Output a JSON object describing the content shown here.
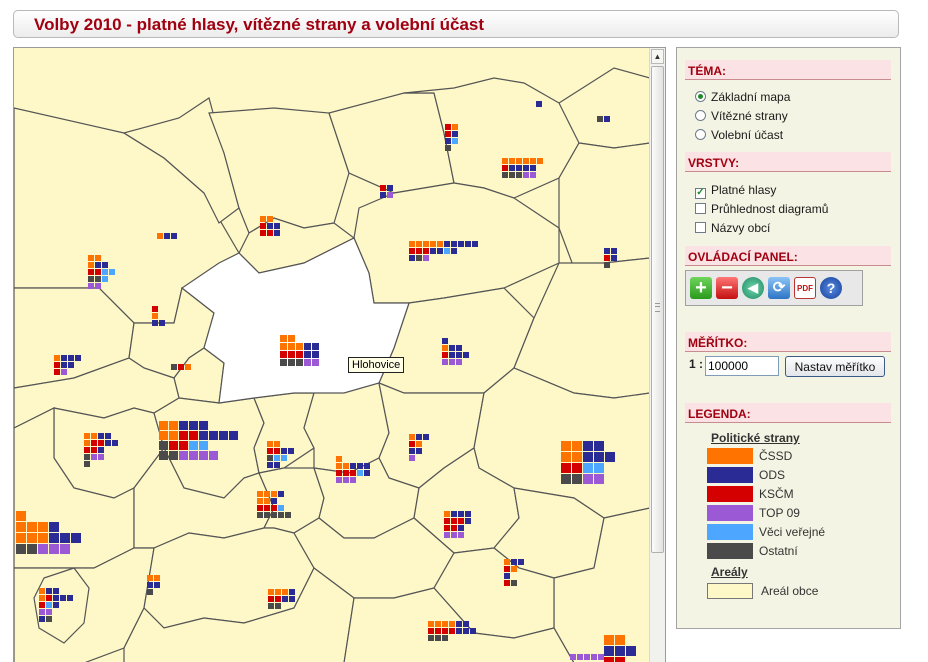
{
  "title": "Volby 2010 - platné hlasy, vítězné strany a volební účast",
  "map": {
    "tooltip": "Hlohovice",
    "fill_color": "#fef8c8",
    "border_color": "#555555"
  },
  "panel": {
    "tema": {
      "heading": "TÉMA:",
      "options": [
        {
          "label": "Základní mapa",
          "selected": true
        },
        {
          "label": "Vítězné strany",
          "selected": false
        },
        {
          "label": "Volební účast",
          "selected": false
        }
      ]
    },
    "vrstvy": {
      "heading": "VRSTVY:",
      "options": [
        {
          "label": "Platné hlasy",
          "checked": true
        },
        {
          "label": "Průhlednost diagramů",
          "checked": false
        },
        {
          "label": "Názvy obcí",
          "checked": false
        }
      ]
    },
    "ovladaci": {
      "heading": "OVLÁDACÍ PANEL:",
      "buttons": [
        "zoom-in-icon",
        "zoom-out-icon",
        "back-icon",
        "refresh-icon",
        "pdf-icon",
        "help-icon"
      ],
      "pdf_text": "PDF"
    },
    "meritko": {
      "heading": "MĚŘÍTKO:",
      "prefix": "1 :",
      "value": "100000",
      "button": "Nastav měřítko"
    },
    "legenda": {
      "heading": "LEGENDA:",
      "parties_title": "Politické strany",
      "parties": [
        {
          "name": "ČSSD",
          "color": "#ff7300"
        },
        {
          "name": "ODS",
          "color": "#2b2b96"
        },
        {
          "name": "KSČM",
          "color": "#d40000"
        },
        {
          "name": "TOP 09",
          "color": "#9b59d6"
        },
        {
          "name": "Věci veřejné",
          "color": "#4da6ff"
        },
        {
          "name": "Ostatní",
          "color": "#4a4a4a"
        }
      ],
      "areas_title": "Areály",
      "area_label": "Areál obce",
      "area_color": "#fef8c8"
    }
  }
}
